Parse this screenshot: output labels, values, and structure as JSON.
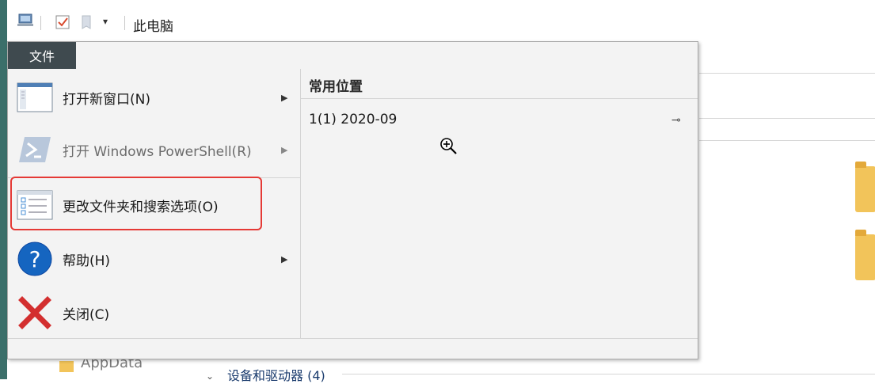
{
  "window": {
    "title": "此电脑"
  },
  "file_menu": {
    "tab_label": "文件",
    "items": [
      {
        "label": "打开新窗口(N)",
        "icon": "new-window-icon",
        "enabled": true,
        "has_submenu": true
      },
      {
        "label": "打开 Windows PowerShell(R)",
        "icon": "powershell-icon",
        "enabled": false,
        "has_submenu": true
      },
      {
        "label": "更改文件夹和搜索选项(O)",
        "icon": "folder-options-icon",
        "enabled": true,
        "has_submenu": false,
        "highlighted": true
      },
      {
        "label": "帮助(H)",
        "icon": "help-icon",
        "enabled": true,
        "has_submenu": true
      },
      {
        "label": "关闭(C)",
        "icon": "close-icon",
        "enabled": true,
        "has_submenu": false
      }
    ],
    "recent": {
      "header": "常用位置",
      "items": [
        {
          "label": "1(1)  2020-09",
          "pinned": true
        }
      ]
    }
  },
  "background": {
    "appdata_label": "AppData",
    "drives_section": "设备和驱动器 (4)"
  },
  "colors": {
    "menu_tab_bg": "#3f4a4f",
    "highlight_border": "#e53935",
    "help_blue": "#1565c0",
    "close_red": "#d32f2f"
  }
}
